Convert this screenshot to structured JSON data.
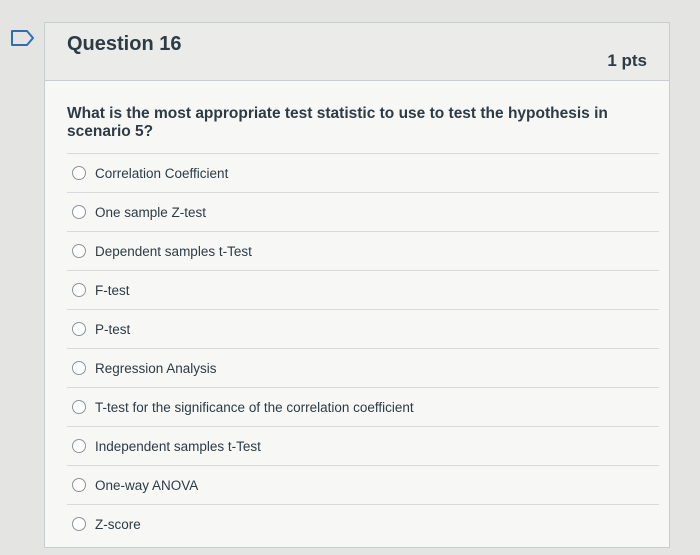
{
  "question": {
    "title": "Question 16",
    "points": "1 pts",
    "text": "What is the most appropriate test statistic to use to test the hypothesis in scenario 5?"
  },
  "flag_icon": "flag-outline-icon",
  "answers": [
    {
      "label": "Correlation Coefficient"
    },
    {
      "label": "One sample Z-test"
    },
    {
      "label": "Dependent samples t-Test"
    },
    {
      "label": "F-test"
    },
    {
      "label": "P-test"
    },
    {
      "label": "Regression Analysis"
    },
    {
      "label": "T-test for the significance of the correlation coefficient"
    },
    {
      "label": "Independent samples t-Test"
    },
    {
      "label": "One-way ANOVA"
    },
    {
      "label": "Z-score"
    }
  ]
}
